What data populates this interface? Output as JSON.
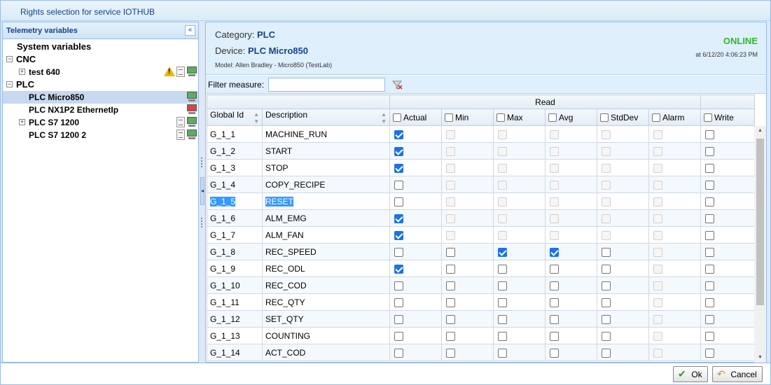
{
  "window": {
    "title": "Rights selection for service IOTHUB"
  },
  "left_panel": {
    "title": "Telemetry variables",
    "collapse_icon": "double-chevron-left-icon",
    "tree": [
      {
        "label": "System variables",
        "level": 0
      },
      {
        "label": "CNC",
        "level": 0
      },
      {
        "label": "test 640",
        "level": 1
      },
      {
        "label": "PLC",
        "level": 0
      },
      {
        "label": "PLC Micro850",
        "level": 1,
        "selected": true
      },
      {
        "label": "PLC NX1P2 EthernetIp",
        "level": 1
      },
      {
        "label": "PLC S7 1200",
        "level": 1
      },
      {
        "label": "PLC S7 1200 2",
        "level": 1
      }
    ]
  },
  "info": {
    "category_label": "Category:",
    "category_value": "PLC",
    "device_label": "Device:",
    "device_value": "PLC Micro850",
    "model": "Model: Allen Bradley - Micro850 (TestLab)",
    "status": "ONLINE",
    "status_color": "#2cba2c",
    "timestamp": "at 6/12/20 4:06:23 PM"
  },
  "filter": {
    "label": "Filter measure:",
    "value": ""
  },
  "grid": {
    "group_read": "Read",
    "columns": {
      "id": "Global Id",
      "desc": "Description",
      "actual": "Actual",
      "min": "Min",
      "max": "Max",
      "avg": "Avg",
      "stddev": "StdDev",
      "alarm": "Alarm",
      "write": "Write"
    },
    "rows": [
      {
        "id": "G_1_1",
        "desc": "MACHINE_RUN",
        "actual": true,
        "min": false,
        "max": false,
        "avg": false,
        "stddev": false,
        "alarm": false,
        "write": false,
        "disabled": true
      },
      {
        "id": "G_1_2",
        "desc": "START",
        "actual": true,
        "min": false,
        "max": false,
        "avg": false,
        "stddev": false,
        "alarm": false,
        "write": false,
        "disabled": true
      },
      {
        "id": "G_1_3",
        "desc": "STOP",
        "actual": true,
        "min": false,
        "max": false,
        "avg": false,
        "stddev": false,
        "alarm": false,
        "write": false,
        "disabled": true
      },
      {
        "id": "G_1_4",
        "desc": "COPY_RECIPE",
        "actual": false,
        "min": false,
        "max": false,
        "avg": false,
        "stddev": false,
        "alarm": false,
        "write": false,
        "disabled": true
      },
      {
        "id": "G_1_5",
        "desc": "RESET",
        "actual": false,
        "min": false,
        "max": false,
        "avg": false,
        "stddev": false,
        "alarm": false,
        "write": false,
        "disabled": true,
        "highlight": true
      },
      {
        "id": "G_1_6",
        "desc": "ALM_EMG",
        "actual": true,
        "min": false,
        "max": false,
        "avg": false,
        "stddev": false,
        "alarm": false,
        "write": false,
        "disabled": true
      },
      {
        "id": "G_1_7",
        "desc": "ALM_FAN",
        "actual": true,
        "min": false,
        "max": false,
        "avg": false,
        "stddev": false,
        "alarm": false,
        "write": false,
        "disabled": true
      },
      {
        "id": "G_1_8",
        "desc": "REC_SPEED",
        "actual": false,
        "min": false,
        "max": true,
        "avg": true,
        "stddev": false,
        "alarm": false,
        "write": false,
        "disabled": false
      },
      {
        "id": "G_1_9",
        "desc": "REC_ODL",
        "actual": true,
        "min": false,
        "max": false,
        "avg": false,
        "stddev": false,
        "alarm": false,
        "write": false,
        "disabled": false
      },
      {
        "id": "G_1_10",
        "desc": "REC_COD",
        "actual": false,
        "min": false,
        "max": false,
        "avg": false,
        "stddev": false,
        "alarm": false,
        "write": false,
        "disabled": false
      },
      {
        "id": "G_1_11",
        "desc": "REC_QTY",
        "actual": false,
        "min": false,
        "max": false,
        "avg": false,
        "stddev": false,
        "alarm": false,
        "write": false,
        "disabled": false
      },
      {
        "id": "G_1_12",
        "desc": "SET_QTY",
        "actual": false,
        "min": false,
        "max": false,
        "avg": false,
        "stddev": false,
        "alarm": false,
        "write": false,
        "disabled": false
      },
      {
        "id": "G_1_13",
        "desc": "COUNTING",
        "actual": false,
        "min": false,
        "max": false,
        "avg": false,
        "stddev": false,
        "alarm": false,
        "write": false,
        "disabled": false
      },
      {
        "id": "G_1_14",
        "desc": "ACT_COD",
        "actual": false,
        "min": false,
        "max": false,
        "avg": false,
        "stddev": false,
        "alarm": true,
        "write": false,
        "disabled": false,
        "alarm_disabled": true
      }
    ]
  },
  "buttons": {
    "ok": "Ok",
    "cancel": "Cancel"
  }
}
